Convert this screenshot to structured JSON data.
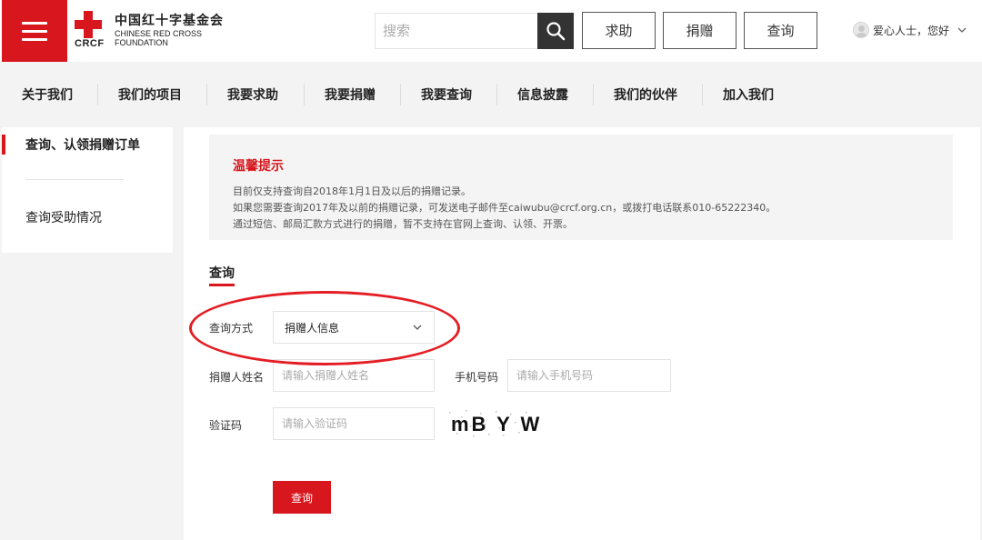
{
  "header": {
    "logo": {
      "cn_name": "中国红十字基金会",
      "en_name_line1": "CHINESE RED CROSS",
      "en_name_line2": "FOUNDATION",
      "abbr": "CRCF"
    },
    "search_placeholder": "搜索",
    "buttons": [
      "求助",
      "捐赠",
      "查询"
    ],
    "user_greeting": "爱心人士，您好"
  },
  "nav": {
    "items": [
      "关于我们",
      "我们的项目",
      "我要求助",
      "我要捐赠",
      "我要查询",
      "信息披露",
      "我们的伙伴",
      "加入我们"
    ]
  },
  "sidebar": {
    "items": [
      "查询、认领捐赠订单",
      "查询受助情况"
    ]
  },
  "notice": {
    "title": "温馨提示",
    "lines": [
      "目前仅支持查询自2018年1月1日及以后的捐赠记录。",
      "如果您需要查询2017年及以前的捐赠记录，可发送电子邮件至caiwubu@crcf.org.cn，或拨打电话联系010-65222340。",
      "通过短信、邮局汇款方式进行的捐赠，暂不支持在官网上查询、认领、开票。"
    ]
  },
  "query": {
    "title": "查询",
    "method_label": "查询方式",
    "method_value": "捐赠人信息",
    "name_label": "捐赠人姓名",
    "name_placeholder": "请输入捐赠人姓名",
    "phone_label": "手机号码",
    "phone_placeholder": "请输入手机号码",
    "captcha_label": "验证码",
    "captcha_placeholder": "请输入验证码",
    "captcha_text": "mB Y W",
    "submit_label": "查询"
  },
  "colors": {
    "brand_red": "#d7161d",
    "annotation_red": "#e31d23"
  },
  "icons": [
    "menu-icon",
    "search-icon",
    "user-avatar-icon",
    "chevron-down-icon"
  ]
}
